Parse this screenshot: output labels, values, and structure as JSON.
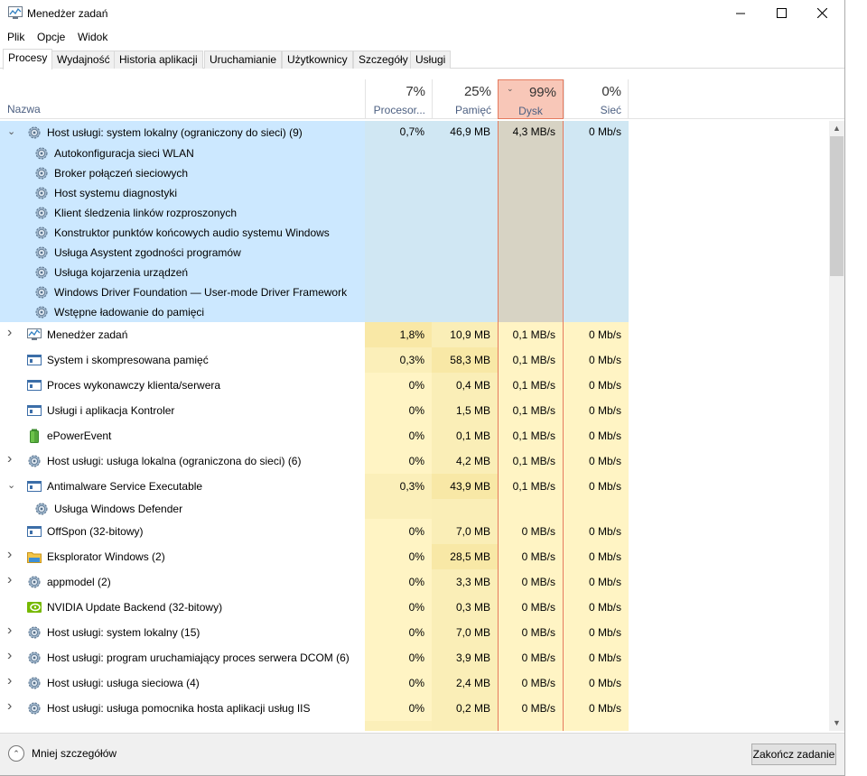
{
  "window": {
    "title": "Menedżer zadań"
  },
  "menu": [
    "Plik",
    "Opcje",
    "Widok"
  ],
  "tabs": [
    "Procesy",
    "Wydajność",
    "Historia aplikacji",
    "Uruchamianie",
    "Użytkownicy",
    "Szczegóły",
    "Usługi"
  ],
  "active_tab": "Procesy",
  "columns": {
    "name": "Nazwa",
    "cpu": {
      "pct": "7%",
      "label": "Procesor..."
    },
    "mem": {
      "pct": "25%",
      "label": "Pamięć"
    },
    "disk": {
      "pct": "99%",
      "label": "Dysk"
    },
    "net": {
      "pct": "0%",
      "label": "Sieć"
    }
  },
  "colors": {
    "selection": "#cce8ff",
    "disk_header": "#f8c7b8",
    "heat": "#fff4c4"
  },
  "rows": [
    {
      "name": "Host usługi: system lokalny (ograniczony do sieci) (9)",
      "icon": "gear-icon",
      "expand": "expanded",
      "cpu": "0,7%",
      "mem": "46,9 MB",
      "disk": "4,3 MB/s",
      "net": "0 Mb/s",
      "group": true
    },
    {
      "name": "Autokonfiguracja sieci WLAN",
      "icon": "gear-icon",
      "child": true,
      "group": true
    },
    {
      "name": "Broker połączeń sieciowych",
      "icon": "gear-icon",
      "child": true,
      "group": true
    },
    {
      "name": "Host systemu diagnostyki",
      "icon": "gear-icon",
      "child": true,
      "group": true
    },
    {
      "name": "Klient śledzenia linków rozproszonych",
      "icon": "gear-icon",
      "child": true,
      "group": true
    },
    {
      "name": "Konstruktor punktów końcowych audio systemu Windows",
      "icon": "gear-icon",
      "child": true,
      "group": true
    },
    {
      "name": "Usługa Asystent zgodności programów",
      "icon": "gear-icon",
      "child": true,
      "group": true
    },
    {
      "name": "Usługa kojarzenia urządzeń",
      "icon": "gear-icon",
      "child": true,
      "group": true
    },
    {
      "name": "Windows Driver Foundation — User-mode Driver Framework",
      "icon": "gear-icon",
      "child": true,
      "group": true
    },
    {
      "name": "Wstępne ładowanie do pamięci",
      "icon": "gear-icon",
      "child": true,
      "group": true
    },
    {
      "name": "Menedżer zadań",
      "icon": "taskmgr-icon",
      "expand": "collapsed",
      "cpu": "1,8%",
      "mem": "10,9 MB",
      "disk": "0,1 MB/s",
      "net": "0 Mb/s"
    },
    {
      "name": "System i skompresowana pamięć",
      "icon": "window-icon",
      "cpu": "0,3%",
      "mem": "58,3 MB",
      "disk": "0,1 MB/s",
      "net": "0 Mb/s"
    },
    {
      "name": "Proces wykonawczy klienta/serwera",
      "icon": "window-icon",
      "cpu": "0%",
      "mem": "0,4 MB",
      "disk": "0,1 MB/s",
      "net": "0 Mb/s"
    },
    {
      "name": "Usługi i aplikacja Kontroler",
      "icon": "window-icon",
      "cpu": "0%",
      "mem": "1,5 MB",
      "disk": "0,1 MB/s",
      "net": "0 Mb/s"
    },
    {
      "name": "ePowerEvent",
      "icon": "battery-icon",
      "cpu": "0%",
      "mem": "0,1 MB",
      "disk": "0,1 MB/s",
      "net": "0 Mb/s"
    },
    {
      "name": "Host usługi: usługa lokalna (ograniczona do sieci) (6)",
      "icon": "gear-icon",
      "expand": "collapsed",
      "cpu": "0%",
      "mem": "4,2 MB",
      "disk": "0,1 MB/s",
      "net": "0 Mb/s"
    },
    {
      "name": "Antimalware Service Executable",
      "icon": "window-icon",
      "expand": "expanded",
      "cpu": "0,3%",
      "mem": "43,9 MB",
      "disk": "0,1 MB/s",
      "net": "0 Mb/s"
    },
    {
      "name": "Usługa Windows Defender",
      "icon": "gear-icon",
      "child": true
    },
    {
      "name": "OffSpon (32-bitowy)",
      "icon": "window-icon",
      "cpu": "0%",
      "mem": "7,0 MB",
      "disk": "0 MB/s",
      "net": "0 Mb/s"
    },
    {
      "name": "Eksplorator Windows (2)",
      "icon": "folder-icon",
      "expand": "collapsed",
      "cpu": "0%",
      "mem": "28,5 MB",
      "disk": "0 MB/s",
      "net": "0 Mb/s"
    },
    {
      "name": "appmodel (2)",
      "icon": "gear-icon",
      "expand": "collapsed",
      "cpu": "0%",
      "mem": "3,3 MB",
      "disk": "0 MB/s",
      "net": "0 Mb/s"
    },
    {
      "name": "NVIDIA Update Backend (32-bitowy)",
      "icon": "nvidia-icon",
      "cpu": "0%",
      "mem": "0,3 MB",
      "disk": "0 MB/s",
      "net": "0 Mb/s"
    },
    {
      "name": "Host usługi: system lokalny (15)",
      "icon": "gear-icon",
      "expand": "collapsed",
      "cpu": "0%",
      "mem": "7,0 MB",
      "disk": "0 MB/s",
      "net": "0 Mb/s"
    },
    {
      "name": "Host usługi: program uruchamiający proces serwera DCOM (6)",
      "icon": "gear-icon",
      "expand": "collapsed",
      "cpu": "0%",
      "mem": "3,9 MB",
      "disk": "0 MB/s",
      "net": "0 Mb/s"
    },
    {
      "name": "Host usługi: usługa sieciowa (4)",
      "icon": "gear-icon",
      "expand": "collapsed",
      "cpu": "0%",
      "mem": "2,4 MB",
      "disk": "0 MB/s",
      "net": "0 Mb/s"
    },
    {
      "name": "Host usługi: usługa pomocnika hosta aplikacji usług IIS",
      "icon": "gear-icon",
      "expand": "collapsed",
      "cpu": "0%",
      "mem": "0,2 MB",
      "disk": "0 MB/s",
      "net": "0 Mb/s"
    }
  ],
  "footer": {
    "less_details": "Mniej szczegółów",
    "end_task": "Zakończ zadanie"
  }
}
